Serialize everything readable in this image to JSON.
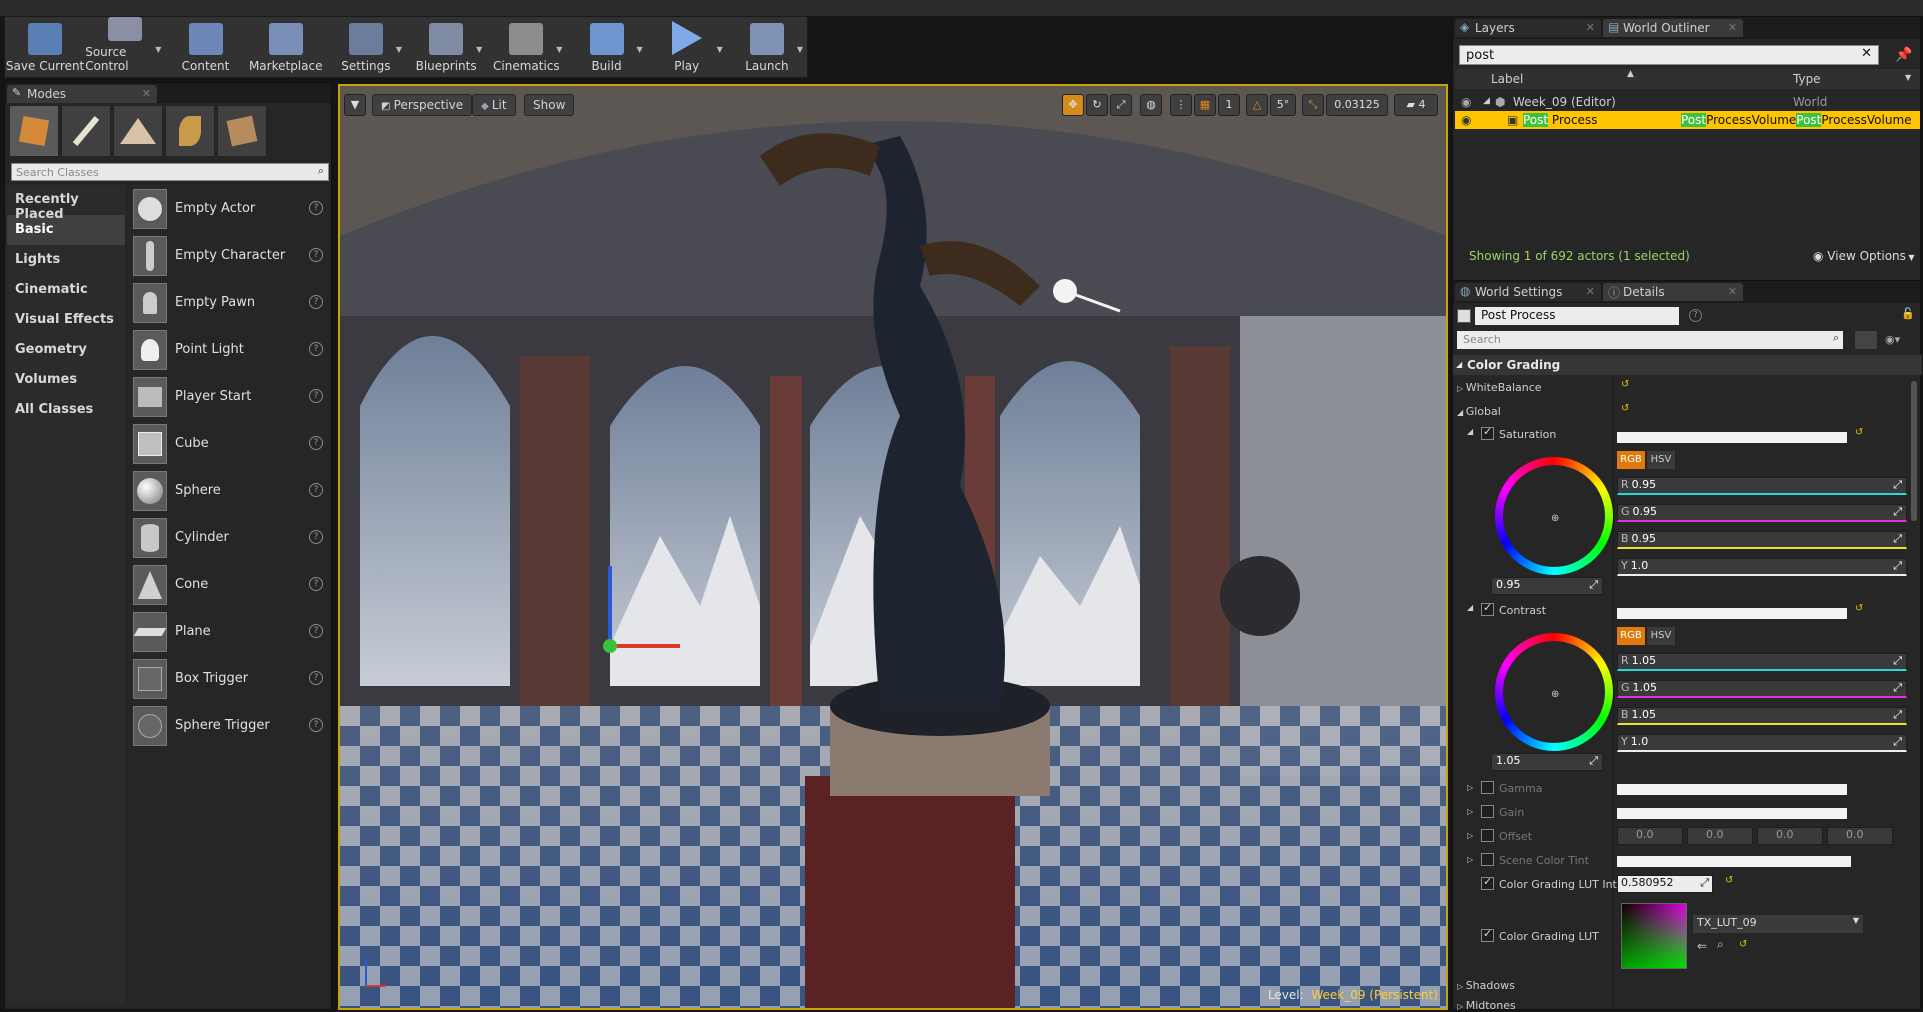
{
  "toolbar": {
    "buttons": [
      {
        "label": "Save Current",
        "icon": "save-icon",
        "color": "#5b7fb5"
      },
      {
        "label": "Source Control",
        "icon": "source-control-icon",
        "color": "#8a8fa6"
      },
      {
        "label": "Content",
        "icon": "content-browser-icon",
        "color": "#6d87b8"
      },
      {
        "label": "Marketplace",
        "icon": "marketplace-icon",
        "color": "#7a8fb8"
      },
      {
        "label": "Settings",
        "icon": "settings-icon",
        "color": "#6a7d9c"
      },
      {
        "label": "Blueprints",
        "icon": "blueprints-icon",
        "color": "#7e8ba3"
      },
      {
        "label": "Cinematics",
        "icon": "cinematics-icon",
        "color": "#8d8d8d"
      },
      {
        "label": "Build",
        "icon": "build-icon",
        "color": "#6f95cf"
      },
      {
        "label": "Play",
        "icon": "play-icon",
        "color": "#7fa9e8"
      },
      {
        "label": "Launch",
        "icon": "launch-icon",
        "color": "#7e92b3"
      }
    ]
  },
  "modes": {
    "tab_label": "Modes",
    "search_placeholder": "Search Classes",
    "categories": [
      "Recently Placed",
      "Basic",
      "Lights",
      "Cinematic",
      "Visual Effects",
      "Geometry",
      "Volumes",
      "All Classes"
    ],
    "selected_category": "Basic",
    "items": [
      "Empty Actor",
      "Empty Character",
      "Empty Pawn",
      "Point Light",
      "Player Start",
      "Cube",
      "Sphere",
      "Cylinder",
      "Cone",
      "Plane",
      "Box Trigger",
      "Sphere Trigger"
    ]
  },
  "viewport": {
    "perspective_label": "Perspective",
    "lit_label": "Lit",
    "show_label": "Show",
    "rotation_snap": "5°",
    "scale_snap": "0.03125",
    "camera_speed": "4",
    "grid_snap": "1",
    "level_prefix": "Level:",
    "level_name": "Week_09 (Persistent)"
  },
  "outliner": {
    "layers_tab": "Layers",
    "world_outliner_tab": "World Outliner",
    "search_value": "post",
    "col_label": "Label",
    "col_type": "Type",
    "rows": [
      {
        "label": "Week_09 (Editor)",
        "type": "World"
      },
      {
        "label_hl": "Post",
        "label_rest": " Process",
        "type_hl1": "Post",
        "type_rest1": "ProcessVolume",
        "type_hl2": "Post",
        "type_rest2": "ProcessVolume"
      }
    ],
    "status": "Showing 1 of 692 actors (1 selected)",
    "view_options": "View Options"
  },
  "details": {
    "world_settings_tab": "World Settings",
    "details_tab": "Details",
    "object_name": "Post Process",
    "search_placeholder": "Search",
    "section": "Color Grading",
    "white_balance": "WhiteBalance",
    "global": "Global",
    "saturation": {
      "label": "Saturation",
      "r": "0.95",
      "g": "0.95",
      "b": "0.95",
      "y": "1.0",
      "wheel_value": "0.95"
    },
    "contrast": {
      "label": "Contrast",
      "r": "1.05",
      "g": "1.05",
      "b": "1.05",
      "y": "1.0",
      "wheel_value": "1.05"
    },
    "rgb_label": "RGB",
    "hsv_label": "HSV",
    "gamma": "Gamma",
    "gain": "Gain",
    "offset": {
      "label": "Offset",
      "values": [
        "0.0",
        "0.0",
        "0.0",
        "0.0"
      ]
    },
    "scene_color_tint": "Scene Color Tint",
    "lut_intensity": {
      "label": "Color Grading LUT Inte",
      "value": "0.580952"
    },
    "lut": {
      "label": "Color Grading LUT",
      "asset": "TX_LUT_09"
    },
    "shadows": "Shadows",
    "midtones": "Midtones",
    "channel_letters": [
      "R",
      "G",
      "B",
      "Y"
    ]
  },
  "colors": {
    "accent": "#e07a0c",
    "selection": "#ffc400",
    "highlight_green": "#3ec23e",
    "viewport_border": "#c9a300"
  }
}
